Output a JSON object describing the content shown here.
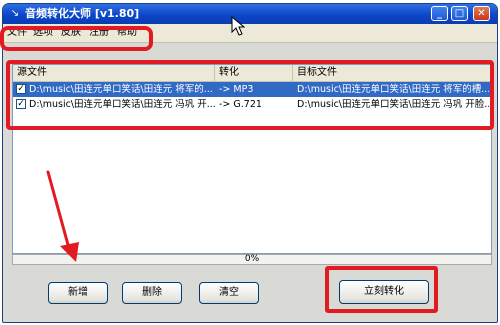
{
  "window": {
    "title": "音频转化大师 [v1.80]",
    "title_icon": "speaker-icon",
    "buttons": {
      "minimize": "_",
      "maximize": "□",
      "close": "✕"
    }
  },
  "menu": [
    "文件",
    "选项",
    "皮肤",
    "注册",
    "帮助"
  ],
  "table": {
    "headers": [
      "源文件",
      "转化",
      "目标文件"
    ],
    "rows": [
      {
        "checked": true,
        "source": "D:\\music\\田连元单口笑话\\田连元 将军的...",
        "convert": "-> MP3",
        "target": "D:\\music\\田连元单口笑话\\田连元 将军的槽..."
      },
      {
        "checked": true,
        "source": "D:\\music\\田连元单口笑话\\田连元 冯巩 开...",
        "convert": "-> G.721",
        "target": "D:\\music\\田连元单口笑话\\田连元 冯巩 开脸..."
      }
    ]
  },
  "progress": {
    "label": "0%",
    "value": 0
  },
  "buttons": {
    "add": "新增",
    "delete": "删除",
    "clear": "清空",
    "convert_now": "立刻转化"
  },
  "colors": {
    "annotation": "#e21b23",
    "selection": "#316ac5",
    "titlebar": "#0b47c9"
  }
}
